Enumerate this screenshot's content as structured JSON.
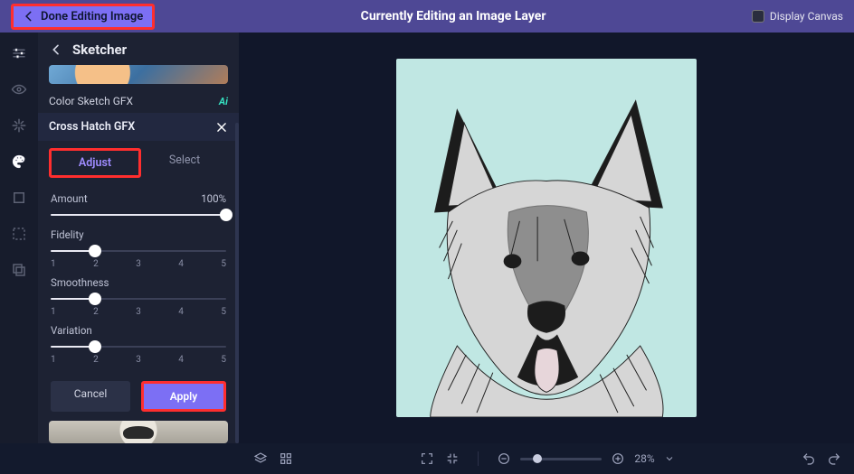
{
  "topbar": {
    "done_label": "Done Editing Image",
    "title": "Currently Editing an Image Layer",
    "display_canvas_label": "Display Canvas"
  },
  "toolstrip": {
    "items": [
      "adjust-icon",
      "eye-icon",
      "sparkle-icon",
      "palette-icon",
      "crop-icon",
      "transform-icon",
      "layers-icon"
    ],
    "active_index": 3
  },
  "panel": {
    "title": "Sketcher",
    "prev_effect": {
      "label": "Color Sketch GFX",
      "ai_badge": "Ai"
    },
    "effect": {
      "label": "Cross Hatch GFX"
    },
    "tabs": {
      "adjust": "Adjust",
      "select": "Select",
      "active": "adjust"
    },
    "sliders": {
      "amount": {
        "label": "Amount",
        "value_text": "100%",
        "pct": 100
      },
      "fidelity": {
        "label": "Fidelity",
        "value": 2,
        "min": 1,
        "max": 5
      },
      "smoothness": {
        "label": "Smoothness",
        "value": 2,
        "min": 1,
        "max": 5
      },
      "variation": {
        "label": "Variation",
        "value": 2,
        "min": 1,
        "max": 5
      }
    },
    "tick_labels": [
      "1",
      "2",
      "3",
      "4",
      "5"
    ],
    "actions": {
      "cancel": "Cancel",
      "apply": "Apply"
    }
  },
  "bottombar": {
    "zoom_pct": "28%"
  }
}
